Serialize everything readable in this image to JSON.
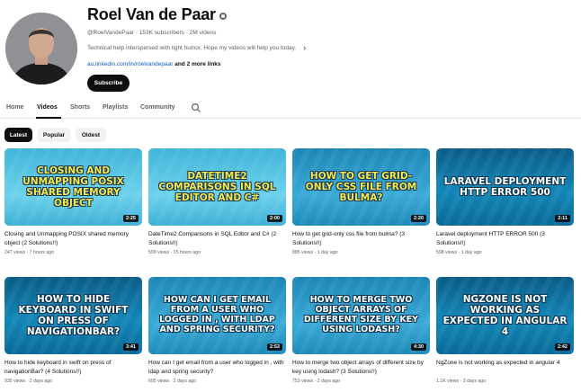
{
  "channel": {
    "name": "Roel Van de Paar",
    "meta": "@RoelVandePaar · 153K subscribers · 2M videos",
    "description": "Technical help interspersed with light humor. Hope my videos will help you today.",
    "link": "au.linkedin.com/in/roelvandepaar",
    "more_links": "and 2 more links",
    "subscribe_label": "Subscribe"
  },
  "tabs": [
    "Home",
    "Videos",
    "Shorts",
    "Playlists",
    "Community"
  ],
  "active_tab": "Videos",
  "chips": [
    "Latest",
    "Popular",
    "Oldest"
  ],
  "selected_chip": "Latest",
  "videos": [
    {
      "thumb_text": "Closing and Unmapping POSIX Shared Memory Object",
      "duration": "2:25",
      "title": "Closing and Unmapping POSIX shared memory object (2 Solutions!!)",
      "meta": "247 views · 7 hours ago"
    },
    {
      "thumb_text": "DateTime2 Comparisons in SQL Editor and C#",
      "duration": "2:00",
      "title": "DateTime2 Comparisons in SQL Editor and C# (2 Solutions!!)",
      "meta": "599 views · 15 hours ago"
    },
    {
      "thumb_text": "How to get grid-only CSS file from bulma?",
      "duration": "2:20",
      "title": "How to get grid-only css file from bulma? (3 Solutions!!)",
      "meta": "885 views · 1 day ago"
    },
    {
      "thumb_text": "Laravel deployment HTTP ERROR 500",
      "duration": "2:11",
      "title": "Laravel deployment HTTP ERROR 500 (3 Solutions!!)",
      "meta": "598 views · 1 day ago"
    },
    {
      "thumb_text": "How to hide keyboard in swift on press of NavigationBar?",
      "duration": "3:41",
      "title": "How to hide keyboard in swift on press of navigationBar? (4 Solutions!!)",
      "meta": "935 views · 2 days ago"
    },
    {
      "thumb_text": "How can I get email from a user who logged in , with ldap and spring security?",
      "duration": "2:53",
      "title": "How can I get email from a user who logged in , with ldap and spring security?",
      "meta": "695 views · 2 days ago"
    },
    {
      "thumb_text": "How to merge two object arrays of different size by key using lodash?",
      "duration": "4:30",
      "title": "How to merge two object arrays of different size by key using lodash? (3 Solutions!!)",
      "meta": "753 views · 2 days ago"
    },
    {
      "thumb_text": "NgZone is not working as expected in angular 4",
      "duration": "2:42",
      "title": "NgZone is not working as expected in angular 4",
      "meta": "1.1K views · 3 days ago"
    }
  ]
}
